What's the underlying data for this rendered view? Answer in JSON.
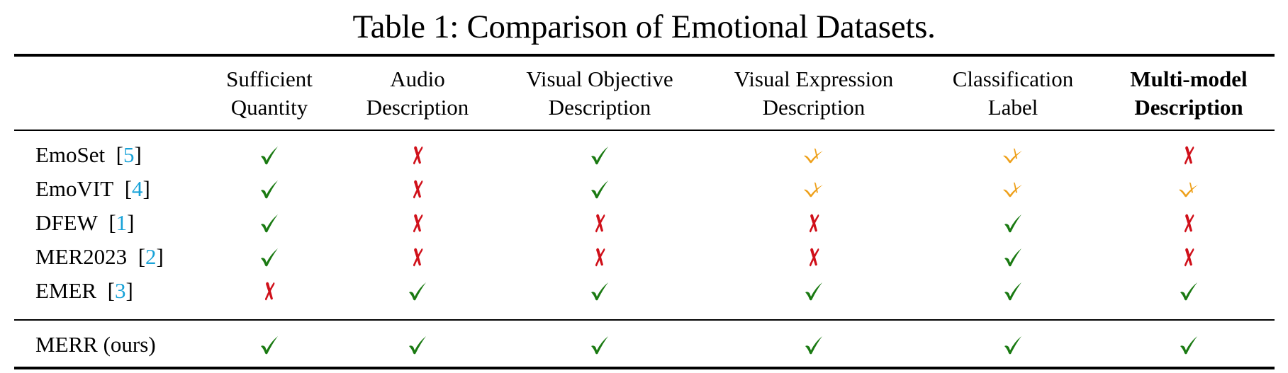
{
  "caption": "Table 1: Comparison of Emotional Datasets.",
  "colors": {
    "yes": "#1a7a12",
    "no": "#d0101a",
    "partial": "#eea01a",
    "citation": "#17a2d8"
  },
  "legend": {
    "yes": "check-icon",
    "no": "cross-icon",
    "partial": "partial-check-icon"
  },
  "columns": [
    {
      "line1": "Sufficient",
      "line2": "Quantity",
      "bold": false
    },
    {
      "line1": "Audio",
      "line2": "Description",
      "bold": false
    },
    {
      "line1": "Visual Objective",
      "line2": "Description",
      "bold": false
    },
    {
      "line1": "Visual Expression",
      "line2": "Description",
      "bold": false
    },
    {
      "line1": "Classification",
      "line2": "Label",
      "bold": false
    },
    {
      "line1": "Multi-model",
      "line2": "Description",
      "bold": true
    }
  ],
  "rows": [
    {
      "name": "EmoSet",
      "cite": "5",
      "values": [
        "yes",
        "no",
        "yes",
        "partial",
        "partial",
        "no"
      ]
    },
    {
      "name": "EmoVIT",
      "cite": "4",
      "values": [
        "yes",
        "no",
        "yes",
        "partial",
        "partial",
        "partial"
      ]
    },
    {
      "name": "DFEW",
      "cite": "1",
      "values": [
        "yes",
        "no",
        "no",
        "no",
        "yes",
        "no"
      ]
    },
    {
      "name": "MER2023",
      "cite": "2",
      "values": [
        "yes",
        "no",
        "no",
        "no",
        "yes",
        "no"
      ]
    },
    {
      "name": "EMER",
      "cite": "3",
      "values": [
        "no",
        "yes",
        "yes",
        "yes",
        "yes",
        "yes"
      ]
    }
  ],
  "ours": {
    "name": "MERR (ours)",
    "values": [
      "yes",
      "yes",
      "yes",
      "yes",
      "yes",
      "yes"
    ]
  }
}
